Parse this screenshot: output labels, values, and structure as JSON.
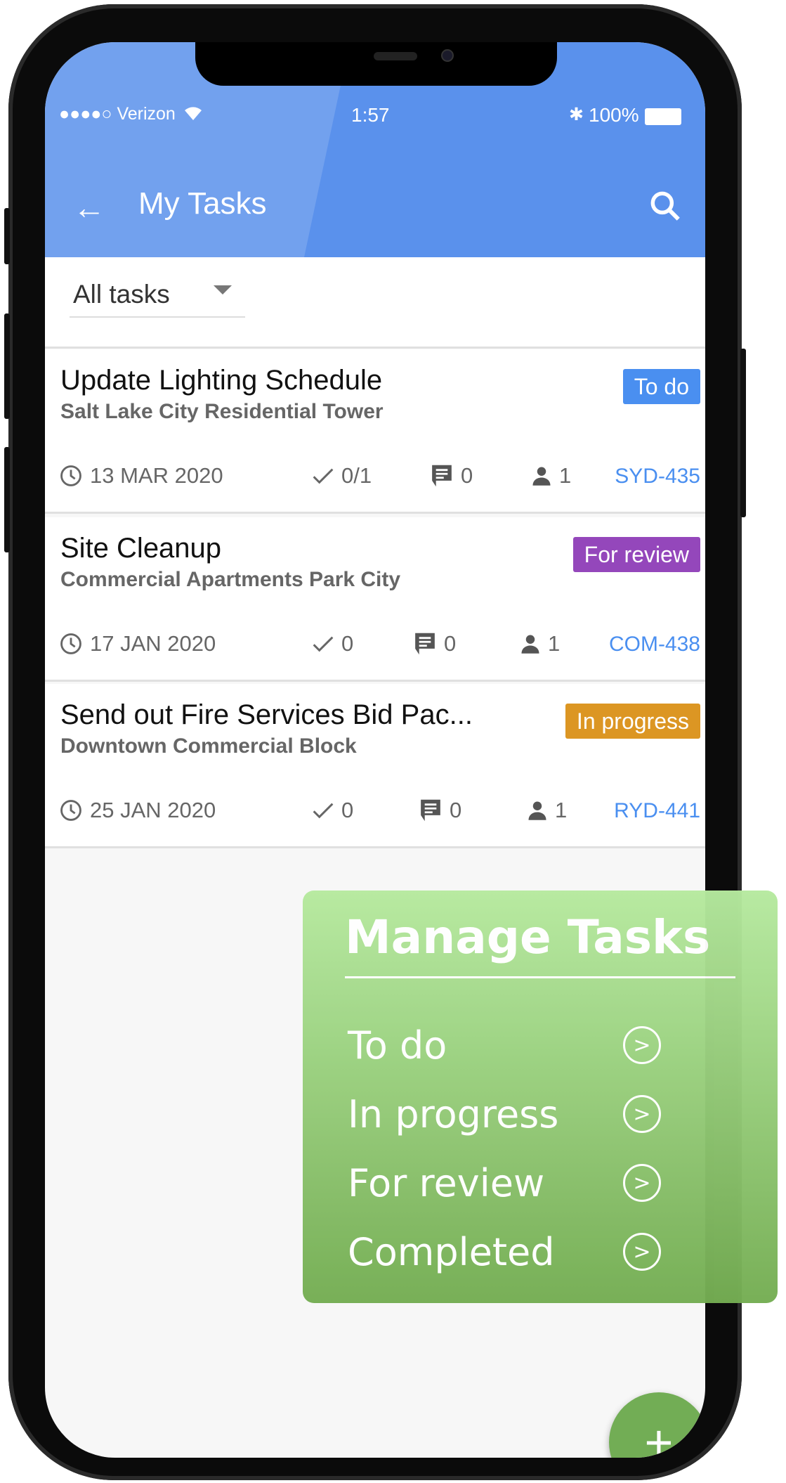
{
  "status_bar": {
    "carrier": "●●●●○ Verizon",
    "time": "1:57",
    "battery": "100%"
  },
  "header": {
    "title": "My Tasks",
    "back_icon": "arrow-left-icon",
    "search_icon": "search-icon",
    "color": "#5a91ec"
  },
  "filter": {
    "selected": "All tasks"
  },
  "tasks": [
    {
      "title": "Update Lighting Schedule",
      "project": "Salt Lake City Residential Tower",
      "status": "To do",
      "status_color": "#4a8ff0",
      "date": "13 MAR 2020",
      "checklist": "0/1",
      "comments": "0",
      "assignees": "1",
      "id": "SYD-435"
    },
    {
      "title": "Site Cleanup",
      "project": "Commercial Apartments Park City",
      "status": "For review",
      "status_color": "#9447bb",
      "date": "17 JAN 2020",
      "checklist": "0",
      "comments": "0",
      "assignees": "1",
      "id": "COM-438"
    },
    {
      "title": "Send out Fire Services Bid Pac...",
      "project": "Downtown Commercial Block",
      "status": "In progress",
      "status_color": "#dc9623",
      "date": "25 JAN 2020",
      "checklist": "0",
      "comments": "0",
      "assignees": "1",
      "id": "RYD-441"
    }
  ],
  "panel": {
    "title": "Manage Tasks",
    "items": [
      {
        "label": "To do"
      },
      {
        "label": "In progress"
      },
      {
        "label": "For review"
      },
      {
        "label": "Completed"
      }
    ]
  },
  "fab": {
    "label": "+"
  }
}
